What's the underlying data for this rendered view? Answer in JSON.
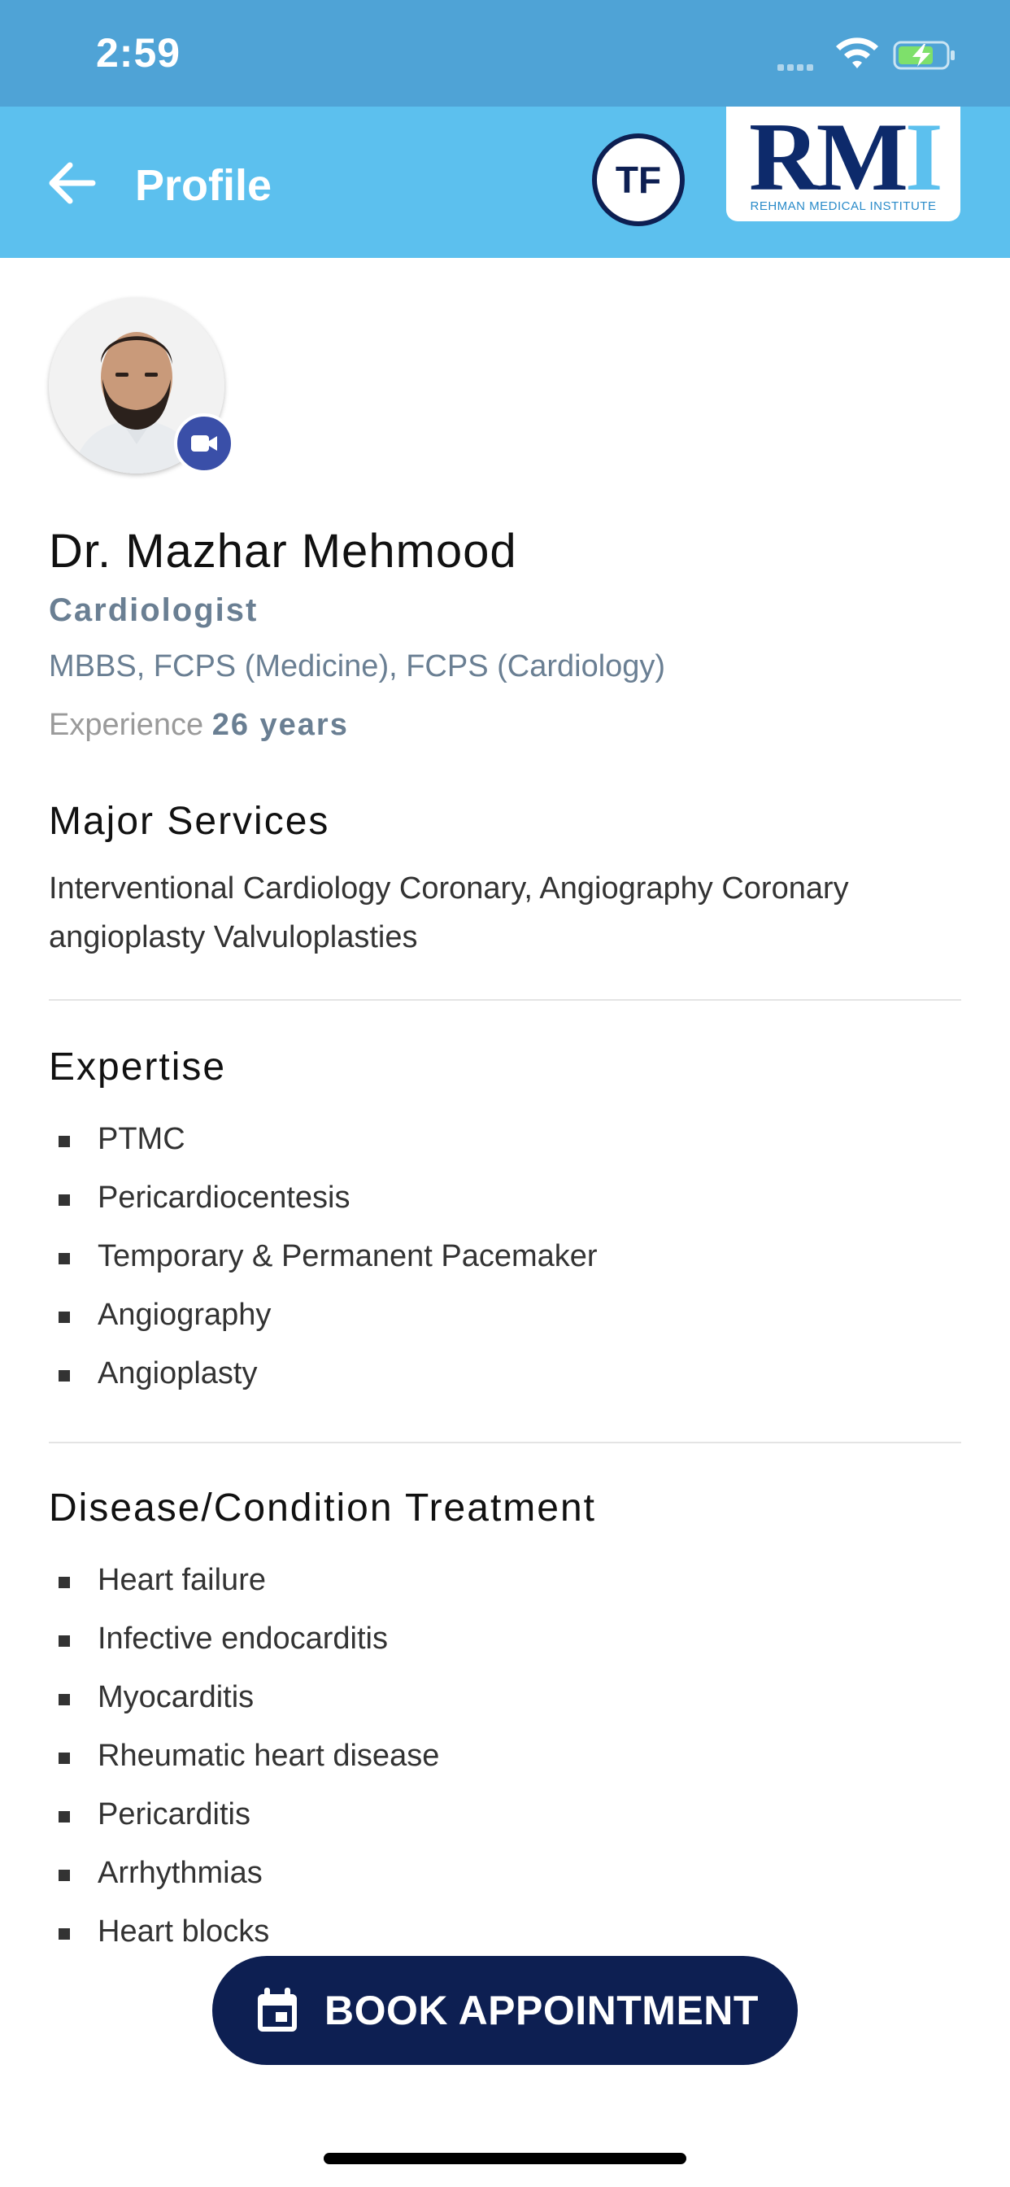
{
  "status_bar": {
    "time": "2:59"
  },
  "header": {
    "title": "Profile",
    "badge_initials": "TF",
    "logo_text": "RMI",
    "logo_subtext": "REHMAN MEDICAL INSTITUTE"
  },
  "doctor": {
    "name": "Dr. Mazhar Mehmood",
    "specialty": "Cardiologist",
    "qualifications": "MBBS, FCPS (Medicine), FCPS (Cardiology)",
    "experience_label": "Experience",
    "experience_value": "26 years"
  },
  "major_services": {
    "title": "Major Services",
    "text": "Interventional Cardiology Coronary, Angiography Coronary angioplasty Valvuloplasties"
  },
  "expertise": {
    "title": "Expertise",
    "items": [
      "PTMC",
      "Pericardiocentesis",
      "Temporary & Permanent Pacemaker",
      "Angiography",
      "Angioplasty"
    ]
  },
  "conditions": {
    "title": "Disease/Condition Treatment",
    "items": [
      "Heart failure",
      "Infective endocarditis",
      "Myocarditis",
      "Rheumatic heart disease",
      "Pericarditis",
      "Arrhythmias",
      "Heart blocks"
    ]
  },
  "book_button": {
    "label": "BOOK APPOINTMENT"
  },
  "icons": {
    "back": "arrow-left-icon",
    "video": "video-camera-icon",
    "calendar": "calendar-icon",
    "wifi": "wifi-icon",
    "battery": "battery-charging-icon"
  },
  "colors": {
    "status_bar": "#4fa3d6",
    "header": "#5cc0ee",
    "primary_dark": "#0d1f52",
    "video_badge": "#3a4fa8",
    "muted_text": "#6a7f93"
  }
}
